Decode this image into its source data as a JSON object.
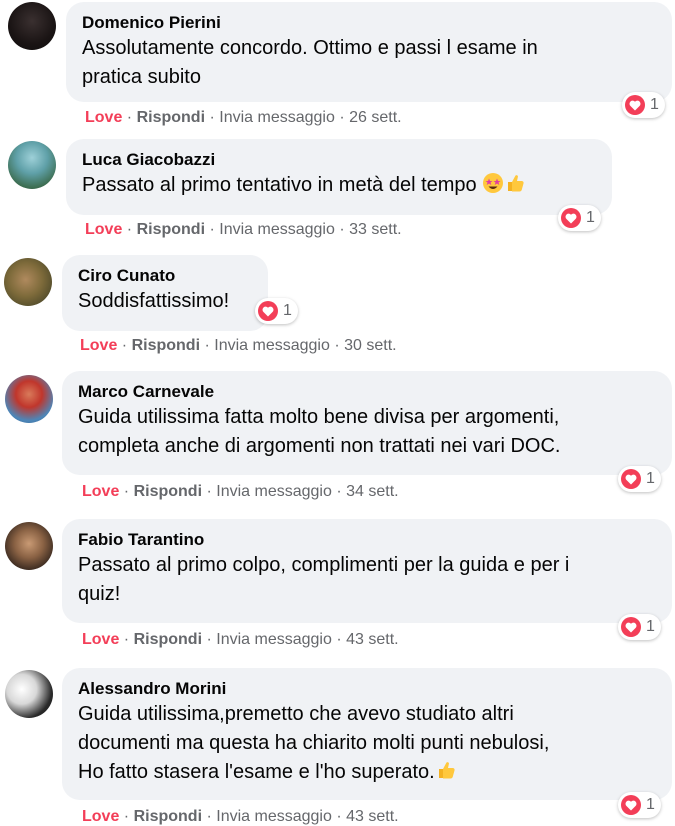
{
  "actions": {
    "love_label": "Love",
    "reply_label": "Rispondi",
    "message_label": "Invia messaggio",
    "separator": "·"
  },
  "comments": [
    {
      "author": "Domenico Pierini",
      "lines": [
        "Assolutamente concordo. Ottimo e passi l esame in",
        "pratica subito"
      ],
      "time": "26 sett.",
      "reaction_count": "1"
    },
    {
      "author": "Luca Giacobazzi",
      "lines": [
        "Passato al primo tentativo in metà del tempo"
      ],
      "time": "33 sett.",
      "reaction_count": "1",
      "emojis": [
        "star-struck-face-emoji",
        "thumbs-up-emoji"
      ]
    },
    {
      "author": "Ciro Cunato",
      "lines": [
        "Soddisfattissimo!"
      ],
      "time": "30 sett.",
      "reaction_count": "1"
    },
    {
      "author": "Marco Carnevale",
      "lines": [
        "Guida utilissima fatta molto bene divisa per argomenti,",
        "completa anche di argomenti non trattati nei vari DOC."
      ],
      "time": "34 sett.",
      "reaction_count": "1"
    },
    {
      "author": "Fabio Tarantino",
      "lines": [
        "Passato al primo colpo, complimenti per la guida e per i",
        "quiz!"
      ],
      "time": "43 sett.",
      "reaction_count": "1"
    },
    {
      "author": "Alessandro Morini",
      "lines": [
        "Guida utilissima,premetto che avevo studiato altri",
        "documenti ma questa ha chiarito molti punti nebulosi,",
        "Ho fatto stasera l'esame e l'ho superato."
      ],
      "time": "43 sett.",
      "reaction_count": "1",
      "emojis": [
        "thumbs-up-emoji"
      ]
    }
  ],
  "colors": {
    "love": "#f33e58",
    "bubble": "#f0f2f5",
    "meta": "#65676b"
  }
}
